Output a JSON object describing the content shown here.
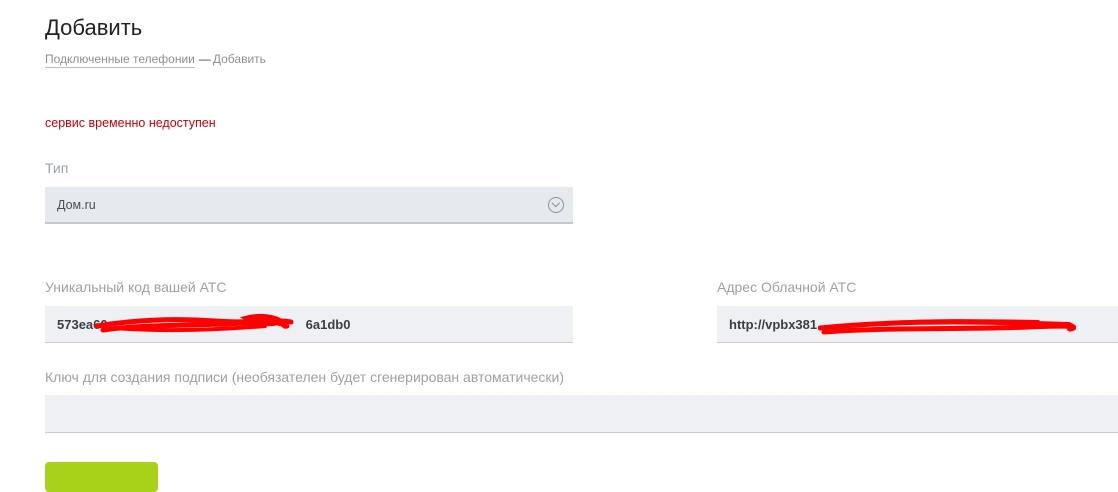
{
  "page": {
    "title": "Добавить"
  },
  "breadcrumb": {
    "parent_label": "Подключенные телефонии",
    "separator": "—",
    "current_label": "Добавить"
  },
  "error": {
    "message": "сервис временно недоступен",
    "color": "#c8000a"
  },
  "form": {
    "type": {
      "label": "Тип",
      "value": "Дом.ru",
      "icon": "chevron-down-circle-icon"
    },
    "ats_code": {
      "label": "Уникальный код вашей АТС",
      "value_start": "573ea60",
      "value_end": "6a1db0"
    },
    "cloud_address": {
      "label": "Адрес Облачной АТС",
      "value_start": "http://vpbx381"
    },
    "signature_key": {
      "label": "Ключ для создания подписи (необязателен будет сгенерирован автоматически)",
      "value": ""
    },
    "submit": {
      "label": "",
      "color": "#a8d21a"
    }
  }
}
